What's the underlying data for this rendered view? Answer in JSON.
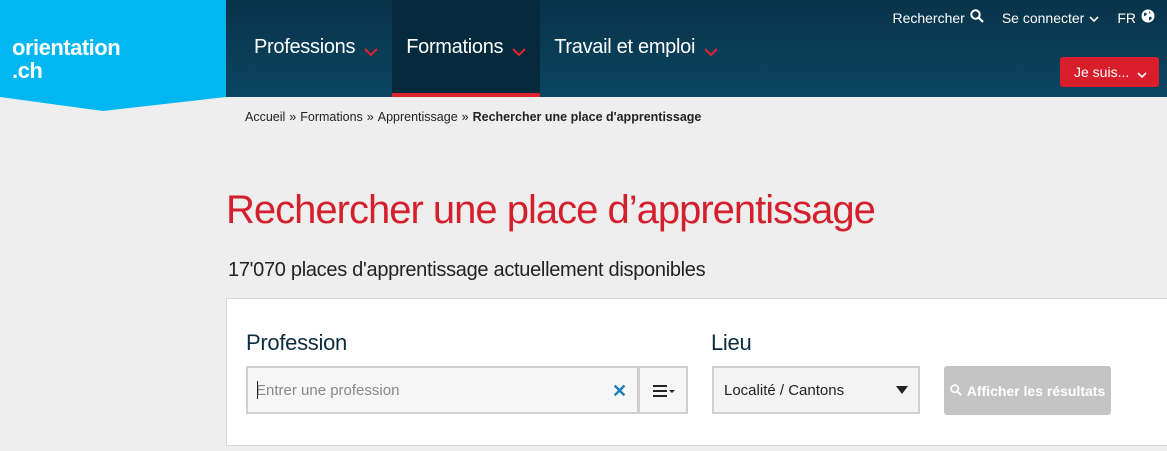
{
  "logo": {
    "line1": "orientation",
    "line2": ".ch"
  },
  "nav": {
    "items": [
      {
        "label": "Professions"
      },
      {
        "label": "Formations"
      },
      {
        "label": "Travail et emploi"
      }
    ]
  },
  "utility": {
    "search_label": "Rechercher",
    "login_label": "Se connecter",
    "lang_label": "FR"
  },
  "je_suis_label": "Je suis...",
  "breadcrumb": {
    "items": [
      "Accueil",
      "Formations",
      "Apprentissage"
    ],
    "separator": "»",
    "current": "Rechercher une place d'apprentissage"
  },
  "page_title": "Rechercher une place d’apprentissage",
  "subtitle": "17'070 places d'apprentissage actuellement disponibles",
  "search": {
    "profession_label": "Profession",
    "profession_placeholder": "Entrer une profession",
    "lieu_label": "Lieu",
    "lieu_value": "Localité / Cantons",
    "submit_label": "Afficher les résultats"
  },
  "colors": {
    "header": "#0b4561",
    "logo_bg": "#00b7f1",
    "accent_red": "#d91e2b",
    "disabled": "#c4c4c4"
  }
}
